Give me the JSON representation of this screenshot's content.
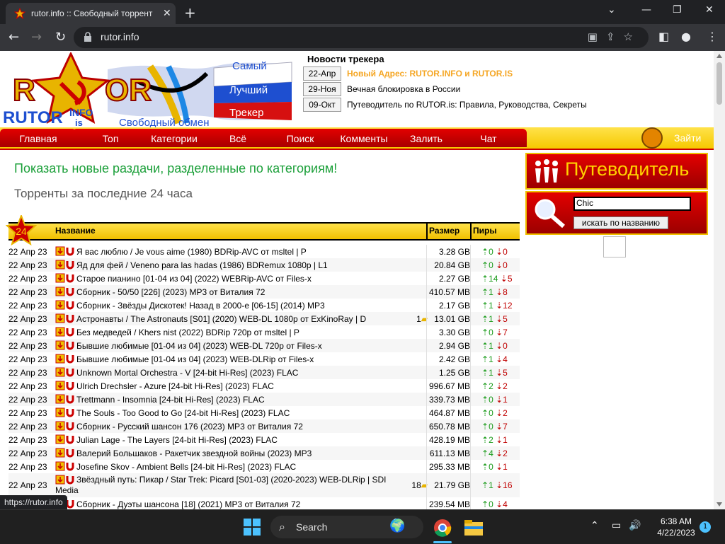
{
  "browser": {
    "tab_title": "rutor.info :: Свободный торрент",
    "url": "rutor.info",
    "status_url": "https://rutor.info"
  },
  "logo": {
    "tagline_words": [
      "Самый",
      "Лучший",
      "Трекер"
    ],
    "brand_sub": "RUTOR",
    "brand_suffix_top": "INFO",
    "brand_suffix_bottom": "is",
    "slogan": "Свободный обмен"
  },
  "news": {
    "title": "Новости трекера",
    "items": [
      {
        "date": "22-Апр",
        "text": "Новый Адрес: RUTOR.INFO и RUTOR.IS",
        "highlight": true
      },
      {
        "date": "29-Ноя",
        "text": "Вечная блокировка в России",
        "highlight": false
      },
      {
        "date": "09-Окт",
        "text": "Путеводитель по RUTOR.is: Правила, Руководства, Секреты",
        "highlight": false
      }
    ]
  },
  "menu": {
    "items": [
      "Главная",
      "Топ",
      "Категории",
      "Всё",
      "Поиск",
      "Комменты",
      "Залить",
      "Чат"
    ],
    "login": "Зайти"
  },
  "content": {
    "new_by_category": "Показать новые раздачи, разделенные по категориям!",
    "last_24h": "Торренты за последние 24 часа",
    "badge": "24",
    "columns": {
      "name": "Название",
      "size": "Размер",
      "peers": "Пиры"
    },
    "rows": [
      {
        "date": "22 Апр 23",
        "name": "Я вас люблю / Je vous aime (1980) BDRip-AVC от msltel | P",
        "comments": "",
        "size": "3.28 GB",
        "seeds": "0",
        "leech": "0"
      },
      {
        "date": "22 Апр 23",
        "name": "Яд для фей / Veneno para las hadas (1986) BDRemux 1080p | L1",
        "comments": "",
        "size": "20.84 GB",
        "seeds": "0",
        "leech": "0"
      },
      {
        "date": "22 Апр 23",
        "name": "Старое пианино [01-04 из 04] (2022) WEBRip-AVC от Files-x",
        "comments": "",
        "size": "2.27 GB",
        "seeds": "14",
        "leech": "5"
      },
      {
        "date": "22 Апр 23",
        "name": "Сборник - 50/50 [226] (2023) MP3 от Виталия 72",
        "comments": "",
        "size": "410.57 MB",
        "seeds": "1",
        "leech": "8"
      },
      {
        "date": "22 Апр 23",
        "name": "Сборник - Звёзды Дискотек! Назад в 2000-е [06-15] (2014) MP3",
        "comments": "",
        "size": "2.17 GB",
        "seeds": "1",
        "leech": "12"
      },
      {
        "date": "22 Апр 23",
        "name": "Астронавты / The Astronauts [S01] (2020) WEB-DL 1080p от ExKinoRay | D",
        "comments": "1",
        "size": "13.01 GB",
        "seeds": "1",
        "leech": "5"
      },
      {
        "date": "22 Апр 23",
        "name": "Без медведей / Khers nist (2022) BDRip 720p от msltel | P",
        "comments": "",
        "size": "3.30 GB",
        "seeds": "0",
        "leech": "7"
      },
      {
        "date": "22 Апр 23",
        "name": "Бывшие любимые [01-04 из 04] (2023) WEB-DL 720p от Files-x",
        "comments": "",
        "size": "2.94 GB",
        "seeds": "1",
        "leech": "0"
      },
      {
        "date": "22 Апр 23",
        "name": "Бывшие любимые [01-04 из 04] (2023) WEB-DLRip от Files-x",
        "comments": "",
        "size": "2.42 GB",
        "seeds": "1",
        "leech": "4"
      },
      {
        "date": "22 Апр 23",
        "name": "Unknown Mortal Orchestra - V [24-bit Hi-Res] (2023) FLAC",
        "comments": "",
        "size": "1.25 GB",
        "seeds": "1",
        "leech": "5"
      },
      {
        "date": "22 Апр 23",
        "name": "Ulrich Drechsler - Azure [24-bit Hi-Res] (2023) FLAC",
        "comments": "",
        "size": "996.67 MB",
        "seeds": "2",
        "leech": "2"
      },
      {
        "date": "22 Апр 23",
        "name": "Trettmann - Insomnia [24-bit Hi-Res] (2023) FLAC",
        "comments": "",
        "size": "339.73 MB",
        "seeds": "0",
        "leech": "1"
      },
      {
        "date": "22 Апр 23",
        "name": "The Souls - Too Good to Go [24-bit Hi-Res] (2023) FLAC",
        "comments": "",
        "size": "464.87 MB",
        "seeds": "0",
        "leech": "2"
      },
      {
        "date": "22 Апр 23",
        "name": "Сборник - Русский шансон 176 (2023) MP3 от Виталия 72",
        "comments": "",
        "size": "650.78 MB",
        "seeds": "0",
        "leech": "7"
      },
      {
        "date": "22 Апр 23",
        "name": "Julian Lage - The Layers [24-bit Hi-Res] (2023) FLAC",
        "comments": "",
        "size": "428.19 MB",
        "seeds": "2",
        "leech": "1"
      },
      {
        "date": "22 Апр 23",
        "name": "Валерий Большаков - Ракетчик звездной войны (2023) MP3",
        "comments": "",
        "size": "611.13 MB",
        "seeds": "4",
        "leech": "2"
      },
      {
        "date": "22 Апр 23",
        "name": "Josefine Skov - Ambient Bells [24-bit Hi-Res] (2023) FLAC",
        "comments": "",
        "size": "295.33 MB",
        "seeds": "0",
        "leech": "1"
      },
      {
        "date": "22 Апр 23",
        "name": "Звёздный путь: Пикар / Star Trek: Picard [S01-03] (2020-2023) WEB-DLRip | SDI Media",
        "comments": "18",
        "size": "21.79 GB",
        "seeds": "1",
        "leech": "16",
        "tall": true
      },
      {
        "date": "",
        "name": "Сборник - Дуэты шансона [18] (2021) MP3 от Виталия 72",
        "comments": "",
        "size": "239.54 MB",
        "seeds": "0",
        "leech": "4"
      }
    ]
  },
  "sidebar": {
    "guide": "Путеводитель",
    "search_value": "Chic",
    "search_button": "искать по названию"
  },
  "taskbar": {
    "search": "Search",
    "time": "6:38 AM",
    "date": "4/22/2023",
    "notifications": "1"
  }
}
